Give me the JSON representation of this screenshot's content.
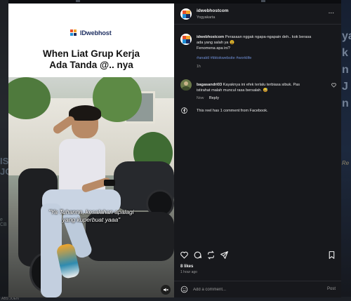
{
  "background": {
    "left_text": "IS JOEN",
    "left_small": "e CB",
    "right_text": "ya\nk\nn\nJ\nn",
    "right_small": "Re",
    "bottom_text": "ABS JOEN"
  },
  "media": {
    "brand": "IDwebhost",
    "headline_line1": "When Liat Grup Kerja",
    "headline_line2": "Ada Tanda @.. nya",
    "caption_line1": "\"Ya Tuhannn, kesalahan apalagi",
    "caption_line2": "yang kuperbuat yaaa\"",
    "mute_icon": "speaker-muted-icon"
  },
  "header": {
    "username": "idwebhostcom",
    "location": "Yogyakarta",
    "more": "..."
  },
  "post": {
    "username": "idwebhostcom",
    "text_line1": "Perasaan nggak ngapa-ngapain deh.. kok berasa",
    "text_line2": "ada yang salah ya 😫",
    "text_line3": "Fenomena apa ini?",
    "hashtags": "#anaktl #tiktokwebsite #worklife",
    "age": "1h"
  },
  "comment": {
    "username": "bagasandri03",
    "text_line1": "Kayaknya ini efek terlalu terbiasa sibuk. Pas",
    "text_line2": "istirahat malah muncul rasa bersalah. 😅",
    "age": "Now",
    "reply_label": "Reply"
  },
  "facebook_note": "This reel has 1 comment from Facebook.",
  "likes": "8 likes",
  "posted_ago": "1 hour ago",
  "add_comment": {
    "placeholder": "Add a comment...",
    "post_label": "Post"
  },
  "colors": {
    "panel_bg": "#17181c",
    "hashtag": "#6f8fd6",
    "brand_blue": "#1a2b5e"
  }
}
